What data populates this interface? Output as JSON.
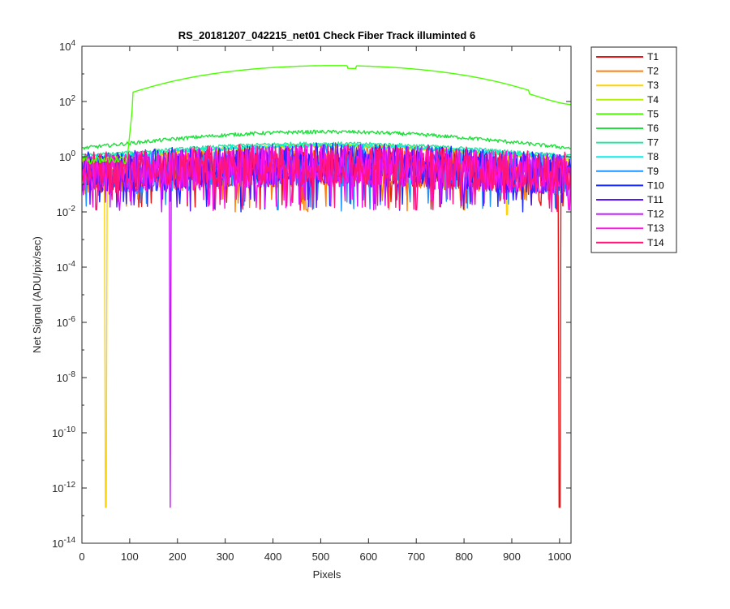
{
  "chart_data": {
    "type": "line",
    "title": "RS_20181207_042215_net01   Check Fiber     Track illuminted 6",
    "xlabel": "Pixels",
    "ylabel": "Net Signal (ADU/pix/sec)",
    "xlim": [
      0,
      1024
    ],
    "ylim": [
      1e-14,
      10000.0
    ],
    "yscale": "log",
    "grid": false,
    "legend_position": "outside-top-right",
    "x_ticks": [
      0,
      100,
      200,
      300,
      400,
      500,
      600,
      700,
      800,
      900,
      1000
    ],
    "x_tick_labels": [
      "0",
      "100",
      "200",
      "300",
      "400",
      "500",
      "600",
      "700",
      "800",
      "900",
      "1000"
    ],
    "y_ticks": [
      {
        "value": 10000.0,
        "base": "10",
        "exp": "4"
      },
      {
        "value": 100.0,
        "base": "10",
        "exp": "2"
      },
      {
        "value": 1.0,
        "base": "10",
        "exp": "0"
      },
      {
        "value": 0.01,
        "base": "10",
        "exp": "-2"
      },
      {
        "value": 0.0001,
        "base": "10",
        "exp": "-4"
      },
      {
        "value": 1e-06,
        "base": "10",
        "exp": "-6"
      },
      {
        "value": 1e-08,
        "base": "10",
        "exp": "-8"
      },
      {
        "value": 1e-10,
        "base": "10",
        "exp": "-10"
      },
      {
        "value": 1e-12,
        "base": "10",
        "exp": "-12"
      },
      {
        "value": 1e-14,
        "base": "10",
        "exp": "-14"
      }
    ],
    "series": [
      {
        "name": "T1",
        "color": "#e81414",
        "baseline": 0.3,
        "dips": [
          [
            1000,
            2e-13
          ]
        ]
      },
      {
        "name": "T2",
        "color": "#ff7f0e",
        "baseline": 0.3,
        "dips": [
          [
            470,
            0.012
          ],
          [
            800,
            0.012
          ]
        ]
      },
      {
        "name": "T3",
        "color": "#ffd400",
        "baseline": 0.4,
        "profile_peak": 2.5,
        "dips": [
          [
            50,
            2e-13
          ],
          [
            890,
            0.008
          ]
        ]
      },
      {
        "name": "T4",
        "color": "#b5f000",
        "baseline": 0.5,
        "profile_peak": 2.5,
        "dips": []
      },
      {
        "name": "T5",
        "color": "#4cff00",
        "baseline": 0.9,
        "profile_peak": 2000,
        "profile_start": 95,
        "dips": []
      },
      {
        "name": "T6",
        "color": "#1fe03c",
        "baseline": 0.9,
        "profile_peak": 8,
        "dips": []
      },
      {
        "name": "T7",
        "color": "#28e6a0",
        "baseline": 0.7,
        "profile_peak": 3,
        "dips": []
      },
      {
        "name": "T8",
        "color": "#00f0f0",
        "baseline": 0.6,
        "profile_peak": 2.5,
        "dips": []
      },
      {
        "name": "T9",
        "color": "#1e96ff",
        "baseline": 0.3,
        "dips": [
          [
            410,
            0.012
          ],
          [
            1020,
            0.012
          ]
        ]
      },
      {
        "name": "T10",
        "color": "#1428ff",
        "baseline": 0.35,
        "dips": []
      },
      {
        "name": "T11",
        "color": "#5a14ff",
        "baseline": 0.3,
        "dips": []
      },
      {
        "name": "T12",
        "color": "#c814ff",
        "baseline": 0.3,
        "dips": [
          [
            185,
            2e-13
          ]
        ]
      },
      {
        "name": "T13",
        "color": "#ff14e6",
        "baseline": 0.3,
        "dips": [
          [
            1020,
            0.012
          ]
        ]
      },
      {
        "name": "T14",
        "color": "#ff1478",
        "baseline": 0.35,
        "dips": [
          [
            30,
            0.012
          ],
          [
            700,
            0.012
          ]
        ]
      }
    ]
  }
}
